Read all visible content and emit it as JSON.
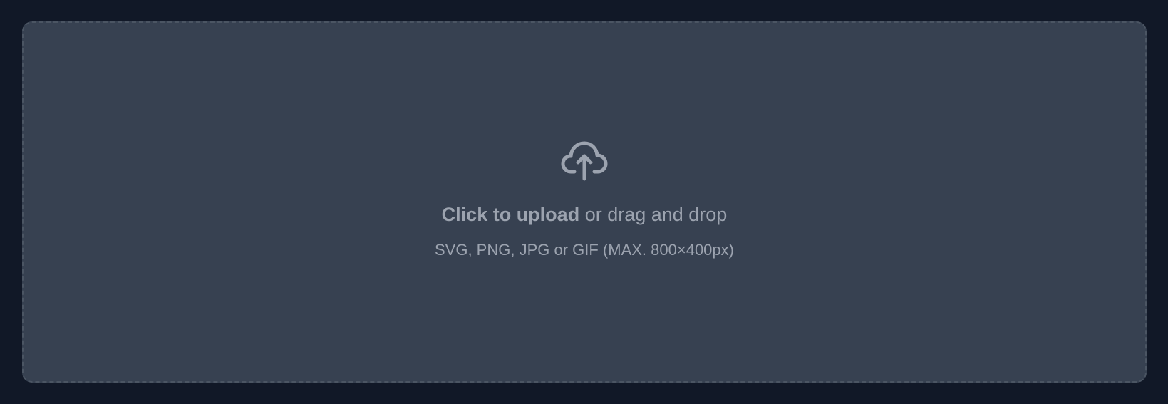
{
  "dropzone": {
    "icon": "cloud-upload-icon",
    "action_text": "Click to upload",
    "secondary_text": " or drag and drop",
    "hint": "SVG, PNG, JPG or GIF (MAX. 800×400px)"
  },
  "colors": {
    "page_background": "#111827",
    "dropzone_background": "#374151",
    "dropzone_border": "#4b5563",
    "text": "#9ca3af"
  }
}
